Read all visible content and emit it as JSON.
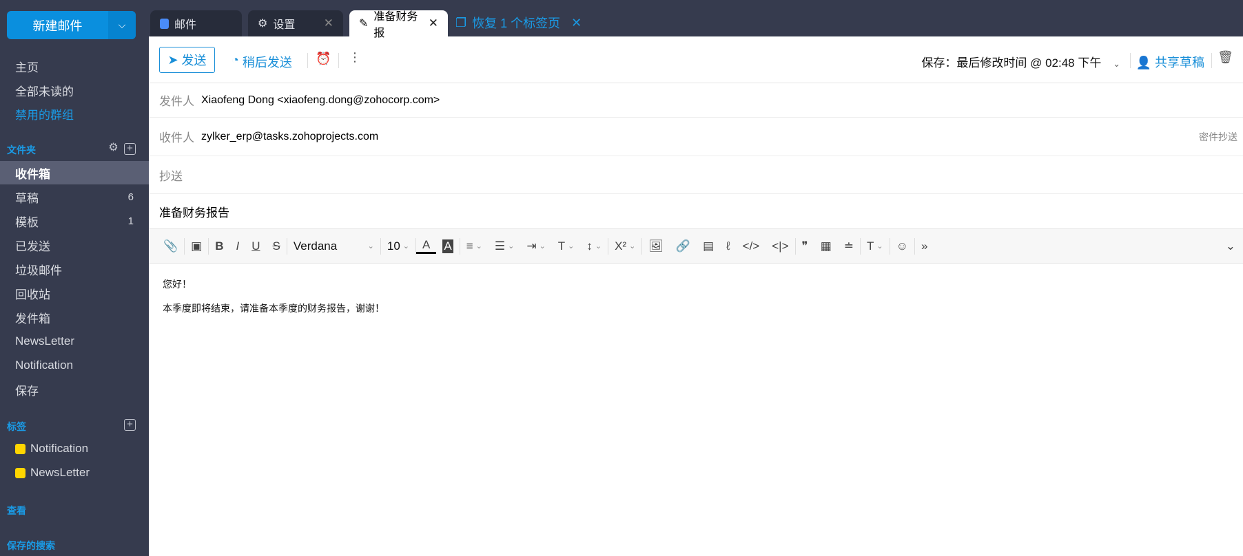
{
  "sidebar": {
    "new_mail": "新建邮件",
    "nav": [
      "主页",
      "全部未读的",
      "禁用的群组"
    ],
    "folders_title": "文件夹",
    "folders": [
      {
        "label": "收件箱",
        "count": ""
      },
      {
        "label": "草稿",
        "count": "6"
      },
      {
        "label": "模板",
        "count": "1"
      },
      {
        "label": "已发送",
        "count": ""
      },
      {
        "label": "垃圾邮件",
        "count": ""
      },
      {
        "label": "回收站",
        "count": ""
      },
      {
        "label": "发件箱",
        "count": ""
      },
      {
        "label": "NewsLetter",
        "count": ""
      },
      {
        "label": "Notification",
        "count": ""
      },
      {
        "label": "保存",
        "count": ""
      }
    ],
    "tags_title": "标签",
    "tags": [
      {
        "label": "Notification",
        "color": "#ffd600"
      },
      {
        "label": "NewsLetter",
        "color": "#ffd600"
      }
    ],
    "views_title": "查看",
    "saved_search_title": "保存的搜索"
  },
  "tabs": [
    {
      "label": "邮件"
    },
    {
      "label": "设置"
    },
    {
      "label": "准备财务报"
    }
  ],
  "restore_tab": "恢复 1 个标签页",
  "toolbar": {
    "send": "发送",
    "send_later": "稍后发送",
    "saved_status": "保存：最后修改时间 @ 02:48 下午",
    "share_draft": "共享草稿"
  },
  "compose": {
    "from_label": "发件人",
    "from": "Xiaofeng Dong <xiaofeng.dong@zohocorp.com>",
    "to_label": "收件人",
    "to": "zylker_erp@tasks.zohoprojects.com",
    "bcc_link": "密件抄送",
    "cc_label": "抄送",
    "subject": "准备财务报告"
  },
  "format": {
    "font": "Verdana",
    "size": "10"
  },
  "body": [
    "您好！",
    "本季度即将结束，请准备本季度的财务报告，谢谢！"
  ]
}
